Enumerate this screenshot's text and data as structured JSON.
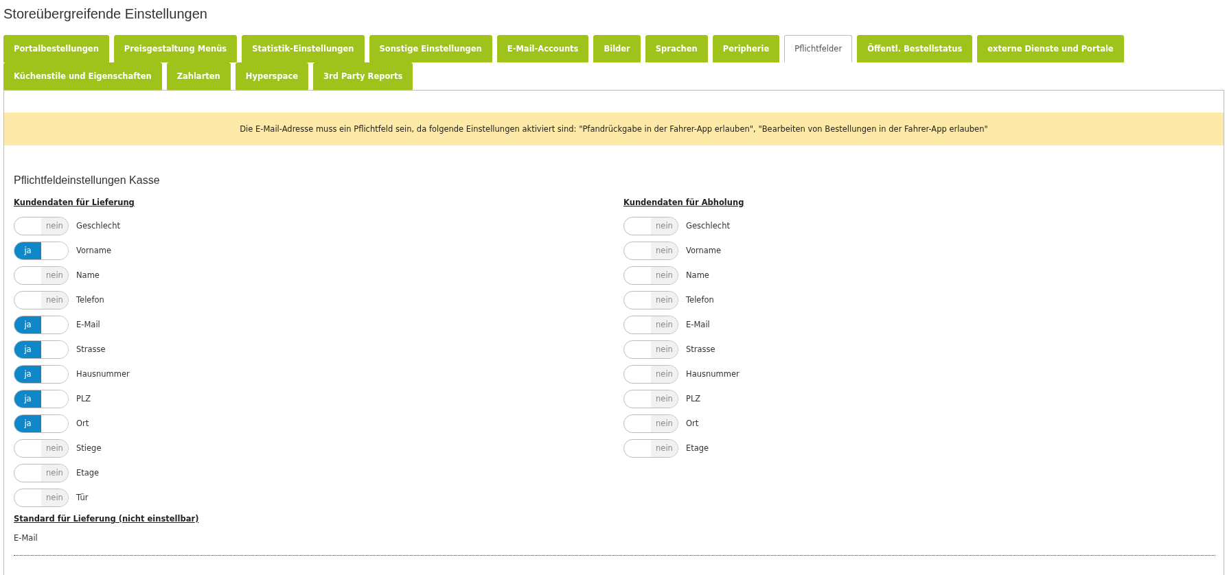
{
  "page_title": "Storeübergreifende Einstellungen",
  "tabs": [
    {
      "label": "Portalbestellungen",
      "selected": false
    },
    {
      "label": "Preisgestaltung Menüs",
      "selected": false
    },
    {
      "label": "Statistik-Einstellungen",
      "selected": false
    },
    {
      "label": "Sonstige Einstellungen",
      "selected": false
    },
    {
      "label": "E-Mail-Accounts",
      "selected": false
    },
    {
      "label": "Bilder",
      "selected": false
    },
    {
      "label": "Sprachen",
      "selected": false
    },
    {
      "label": "Peripherie",
      "selected": false
    },
    {
      "label": "Pflichtfelder",
      "selected": true
    },
    {
      "label": "Öffentl. Bestellstatus",
      "selected": false
    },
    {
      "label": "externe Dienste und Portale",
      "selected": false
    },
    {
      "label": "Küchenstile und Eigenschaften",
      "selected": false
    },
    {
      "label": "Zahlarten",
      "selected": false
    },
    {
      "label": "Hyperspace",
      "selected": false
    },
    {
      "label": "3rd Party Reports",
      "selected": false
    }
  ],
  "notice": "Die E-Mail-Adresse muss ein Pflichtfeld sein, da folgende Einstellungen aktiviert sind: \"Pfandrückgabe in der Fahrer-App erlauben\", \"Bearbeiten von Bestellungen in der Fahrer-App erlauben\"",
  "section_title": "Pflichtfeldeinstellungen Kasse",
  "columns": [
    {
      "heading": "Kundendaten für Lieferung",
      "fields": [
        {
          "label": "Geschlecht",
          "checked": false,
          "toggle_text": "nein"
        },
        {
          "label": "Vorname",
          "checked": true,
          "toggle_text": "ja"
        },
        {
          "label": "Name",
          "checked": false,
          "toggle_text": "nein"
        },
        {
          "label": "Telefon",
          "checked": false,
          "toggle_text": "nein"
        },
        {
          "label": "E-Mail",
          "checked": true,
          "toggle_text": "ja"
        },
        {
          "label": "Strasse",
          "checked": true,
          "toggle_text": "ja"
        },
        {
          "label": "Hausnummer",
          "checked": true,
          "toggle_text": "ja"
        },
        {
          "label": "PLZ",
          "checked": true,
          "toggle_text": "ja"
        },
        {
          "label": "Ort",
          "checked": true,
          "toggle_text": "ja"
        },
        {
          "label": "Stiege",
          "checked": false,
          "toggle_text": "nein"
        },
        {
          "label": "Etage",
          "checked": false,
          "toggle_text": "nein"
        },
        {
          "label": "Tür",
          "checked": false,
          "toggle_text": "nein"
        }
      ],
      "default_heading": "Standard für Lieferung (nicht einstellbar)",
      "default_value": "E-Mail"
    },
    {
      "heading": "Kundendaten für Abholung",
      "fields": [
        {
          "label": "Geschlecht",
          "checked": false,
          "toggle_text": "nein"
        },
        {
          "label": "Vorname",
          "checked": false,
          "toggle_text": "nein"
        },
        {
          "label": "Name",
          "checked": false,
          "toggle_text": "nein"
        },
        {
          "label": "Telefon",
          "checked": false,
          "toggle_text": "nein"
        },
        {
          "label": "E-Mail",
          "checked": false,
          "toggle_text": "nein"
        },
        {
          "label": "Strasse",
          "checked": false,
          "toggle_text": "nein"
        },
        {
          "label": "Hausnummer",
          "checked": false,
          "toggle_text": "nein"
        },
        {
          "label": "PLZ",
          "checked": false,
          "toggle_text": "nein"
        },
        {
          "label": "Ort",
          "checked": false,
          "toggle_text": "nein"
        },
        {
          "label": "Etage",
          "checked": false,
          "toggle_text": "nein"
        }
      ]
    }
  ]
}
